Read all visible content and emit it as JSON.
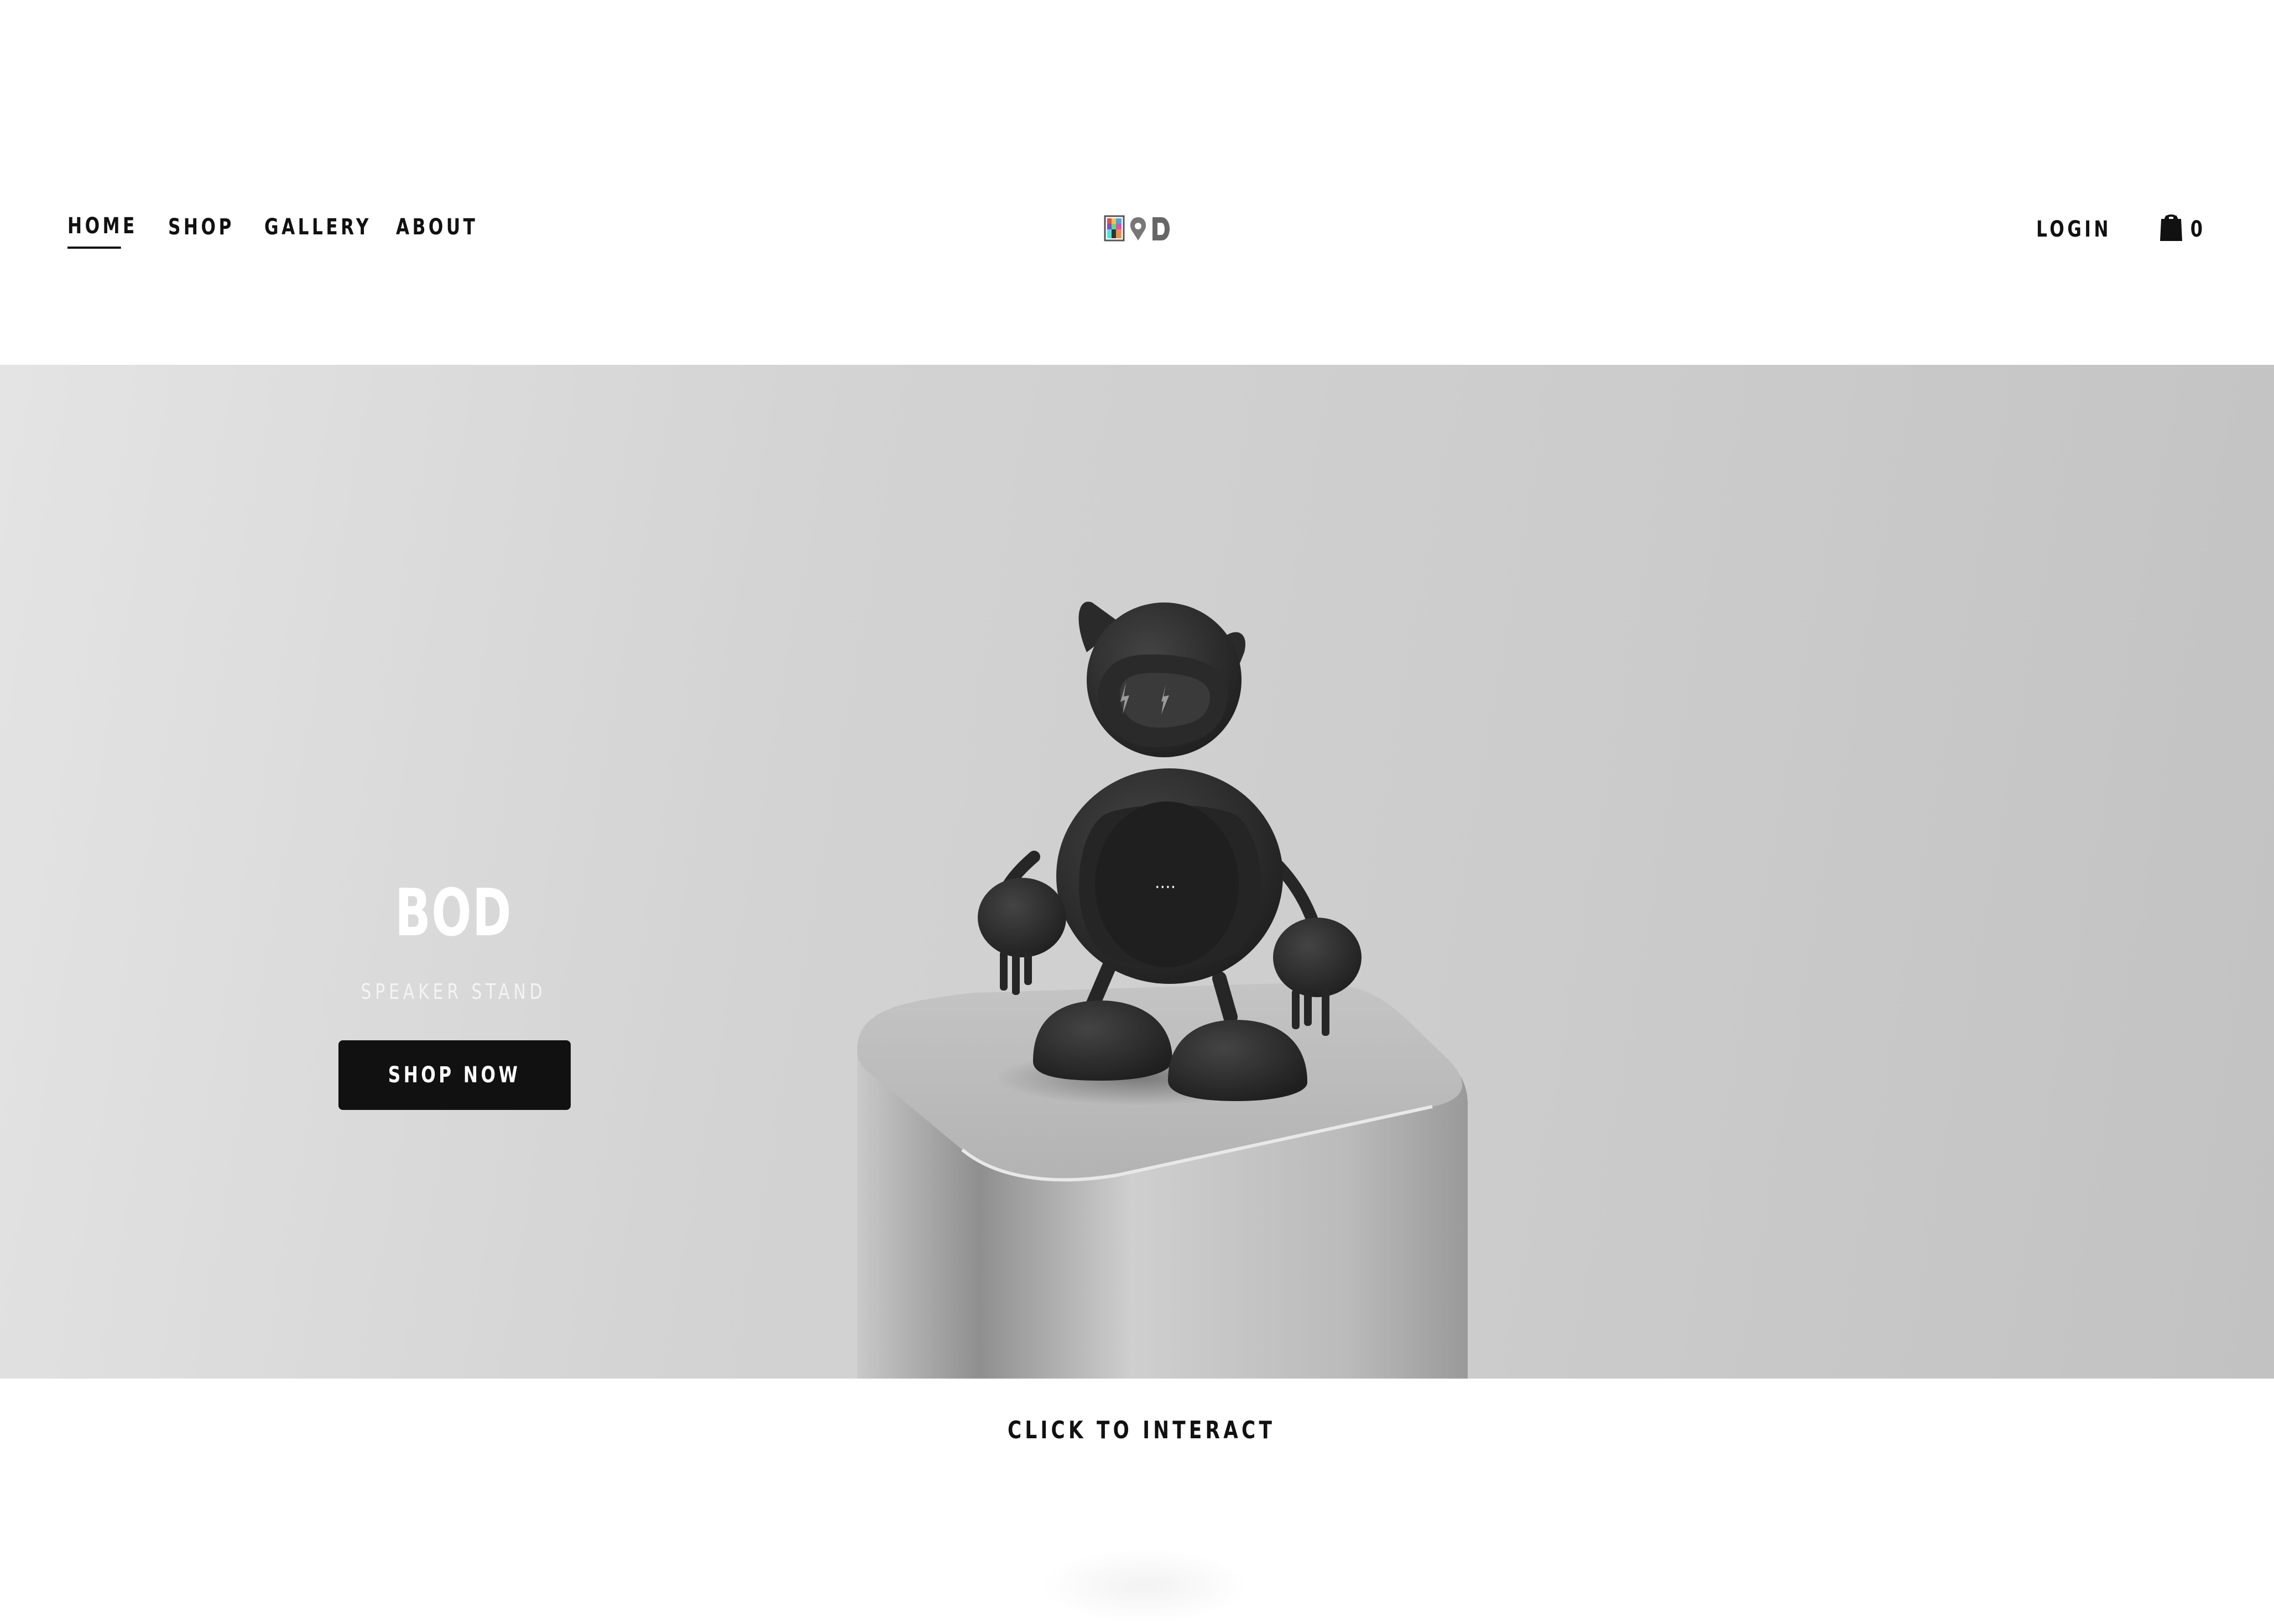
{
  "nav": {
    "items": [
      {
        "label": "HOME",
        "active": true
      },
      {
        "label": "SHOP",
        "active": false
      },
      {
        "label": "GALLERY",
        "active": false
      },
      {
        "label": "ABOUT",
        "active": false
      }
    ]
  },
  "header": {
    "logo_icon": "bod-logo-icon",
    "login_label": "LOGIN",
    "cart_icon": "shopping-bag-icon",
    "cart_count": "0"
  },
  "hero": {
    "title": "BOD",
    "subtitle": "SPEAKER STAND",
    "button_label": "SHOP NOW",
    "screen_text": "····"
  },
  "footer": {
    "cta_label": "CLICK TO INTERACT"
  },
  "colors": {
    "text_dark": "#111111",
    "button_bg": "#111111",
    "hero_bg_light": "#e4e4e4",
    "hero_bg_dark": "#c2c2c2",
    "figure": "#2b2b2b",
    "pedestal": "#b8b8b8"
  }
}
